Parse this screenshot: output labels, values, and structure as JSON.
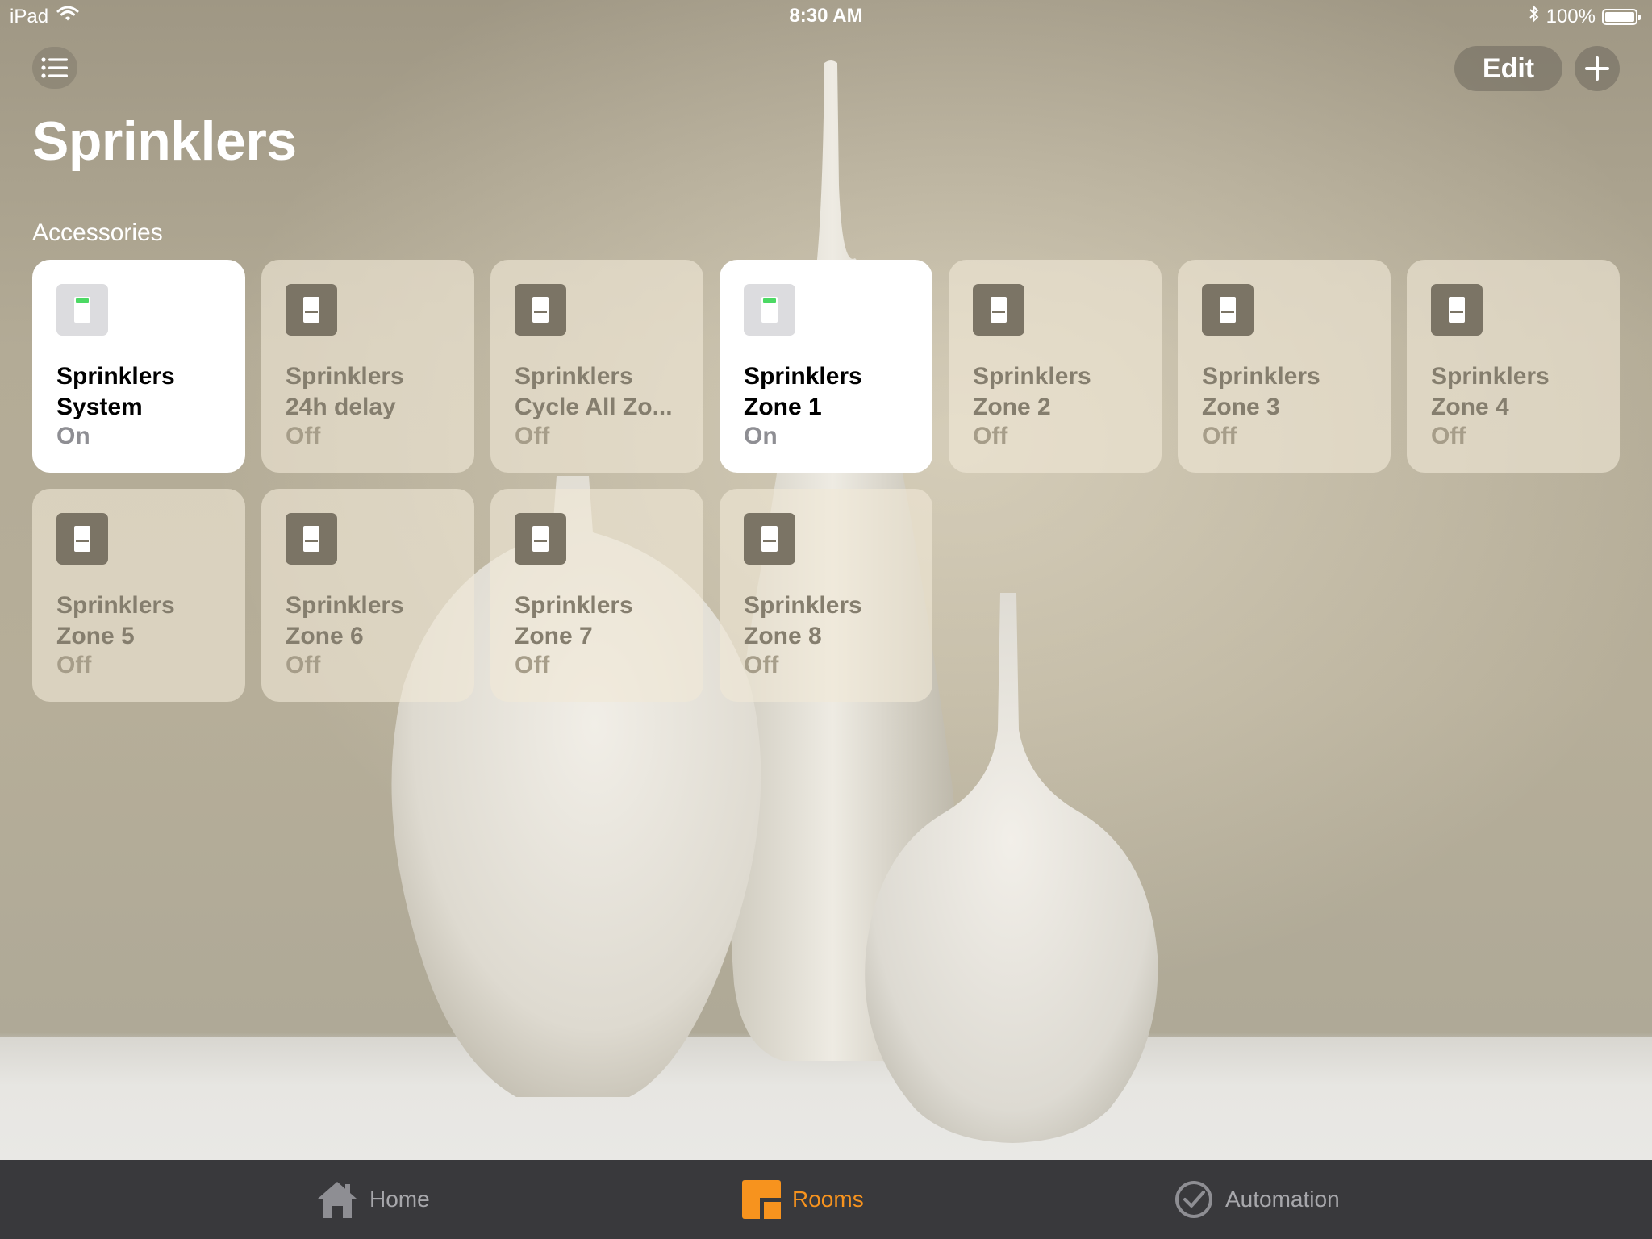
{
  "status_bar": {
    "device": "iPad",
    "time": "8:30 AM",
    "battery": "100%",
    "icons": [
      "wifi-icon",
      "bluetooth-icon",
      "battery-icon"
    ]
  },
  "header": {
    "edit_label": "Edit",
    "title": "Sprinklers",
    "section_label": "Accessories"
  },
  "colors": {
    "on_indicator": "#4cd964",
    "active_tab": "#f7931e",
    "tab_bar": "#39393c"
  },
  "accessories": [
    {
      "line1": "Sprinklers",
      "line2": "System",
      "state": "On",
      "on": true
    },
    {
      "line1": "Sprinklers",
      "line2": "24h delay",
      "state": "Off",
      "on": false
    },
    {
      "line1": "Sprinklers",
      "line2": "Cycle All Zo...",
      "state": "Off",
      "on": false
    },
    {
      "line1": "Sprinklers",
      "line2": "Zone 1",
      "state": "On",
      "on": true
    },
    {
      "line1": "Sprinklers",
      "line2": "Zone 2",
      "state": "Off",
      "on": false
    },
    {
      "line1": "Sprinklers",
      "line2": "Zone 3",
      "state": "Off",
      "on": false
    },
    {
      "line1": "Sprinklers",
      "line2": "Zone 4",
      "state": "Off",
      "on": false
    },
    {
      "line1": "Sprinklers",
      "line2": "Zone 5",
      "state": "Off",
      "on": false
    },
    {
      "line1": "Sprinklers",
      "line2": "Zone 6",
      "state": "Off",
      "on": false
    },
    {
      "line1": "Sprinklers",
      "line2": "Zone 7",
      "state": "Off",
      "on": false
    },
    {
      "line1": "Sprinklers",
      "line2": "Zone 8",
      "state": "Off",
      "on": false
    }
  ],
  "tabs": [
    {
      "label": "Home",
      "icon": "house-icon",
      "active": false
    },
    {
      "label": "Rooms",
      "icon": "rooms-icon",
      "active": true
    },
    {
      "label": "Automation",
      "icon": "clock-check-icon",
      "active": false
    }
  ]
}
